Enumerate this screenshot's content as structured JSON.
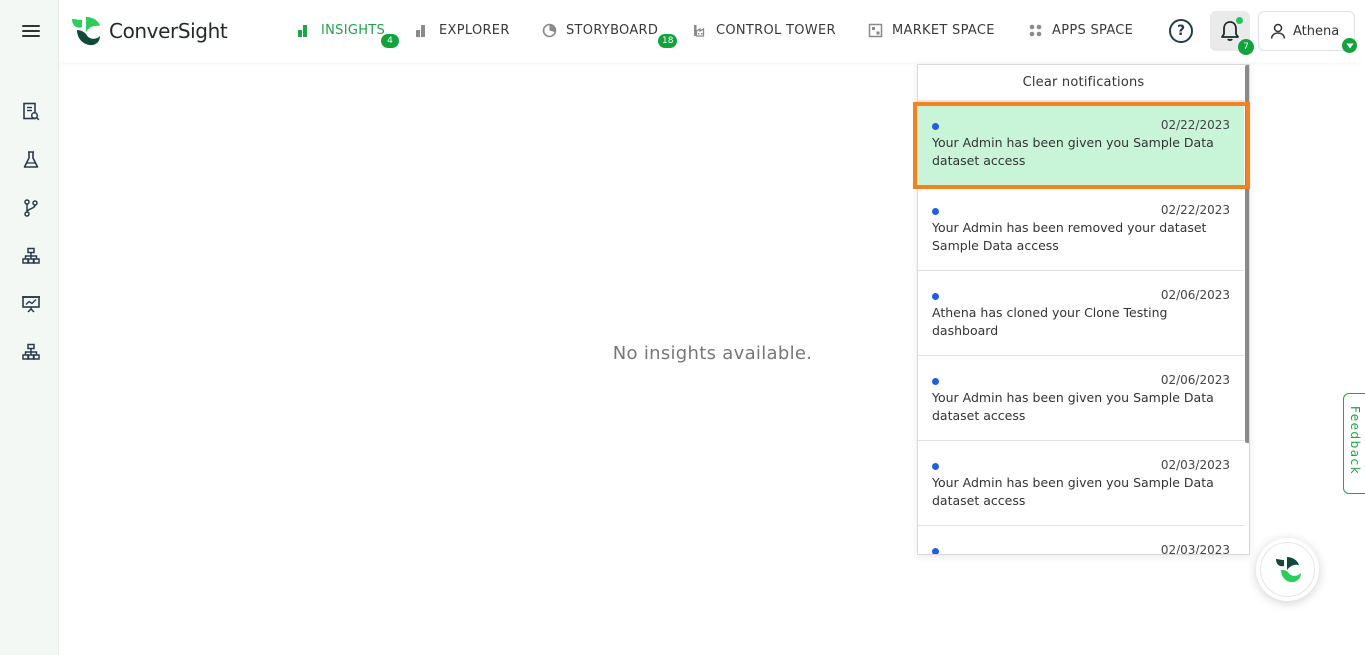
{
  "app": {
    "name": "ConverSight",
    "accent": "#22a24a",
    "badge_color": "#12a33d"
  },
  "sidebar": {
    "items": [
      {
        "icon": "report-search-icon"
      },
      {
        "icon": "flask-icon"
      },
      {
        "icon": "branch-icon"
      },
      {
        "icon": "hierarchy-icon"
      },
      {
        "icon": "presentation-chart-icon"
      },
      {
        "icon": "hierarchy-icon"
      }
    ]
  },
  "nav": {
    "items": [
      {
        "label": "INSIGHTS",
        "icon": "bar-chart-icon",
        "active": true,
        "badge": "4"
      },
      {
        "label": "EXPLORER",
        "icon": "bar-chart-icon",
        "active": false
      },
      {
        "label": "STORYBOARD",
        "icon": "pie-chart-icon",
        "active": false,
        "badge": "18"
      },
      {
        "label": "CONTROL TOWER",
        "icon": "factory-icon",
        "active": false
      },
      {
        "label": "MARKET SPACE",
        "icon": "market-icon",
        "active": false
      },
      {
        "label": "APPS SPACE",
        "icon": "grid-icon",
        "active": false
      }
    ]
  },
  "header": {
    "help": "?",
    "notifications_count": "7",
    "user_name": "Athena"
  },
  "main": {
    "empty_message": "No insights available."
  },
  "notifications": {
    "clear_label": "Clear notifications",
    "items": [
      {
        "date": "02/22/2023",
        "text": "Your Admin has been given you Sample Data dataset access",
        "highlighted": true
      },
      {
        "date": "02/22/2023",
        "text": "Your Admin has been removed your dataset Sample Data access"
      },
      {
        "date": "02/06/2023",
        "text": "Athena has cloned your Clone Testing dashboard"
      },
      {
        "date": "02/06/2023",
        "text": "Your Admin has been given you Sample Data dataset access"
      },
      {
        "date": "02/03/2023",
        "text": "Your Admin has been given you Sample Data dataset access"
      },
      {
        "date": "02/03/2023",
        "text": ""
      }
    ]
  },
  "feedback": {
    "label": "Feedback"
  }
}
